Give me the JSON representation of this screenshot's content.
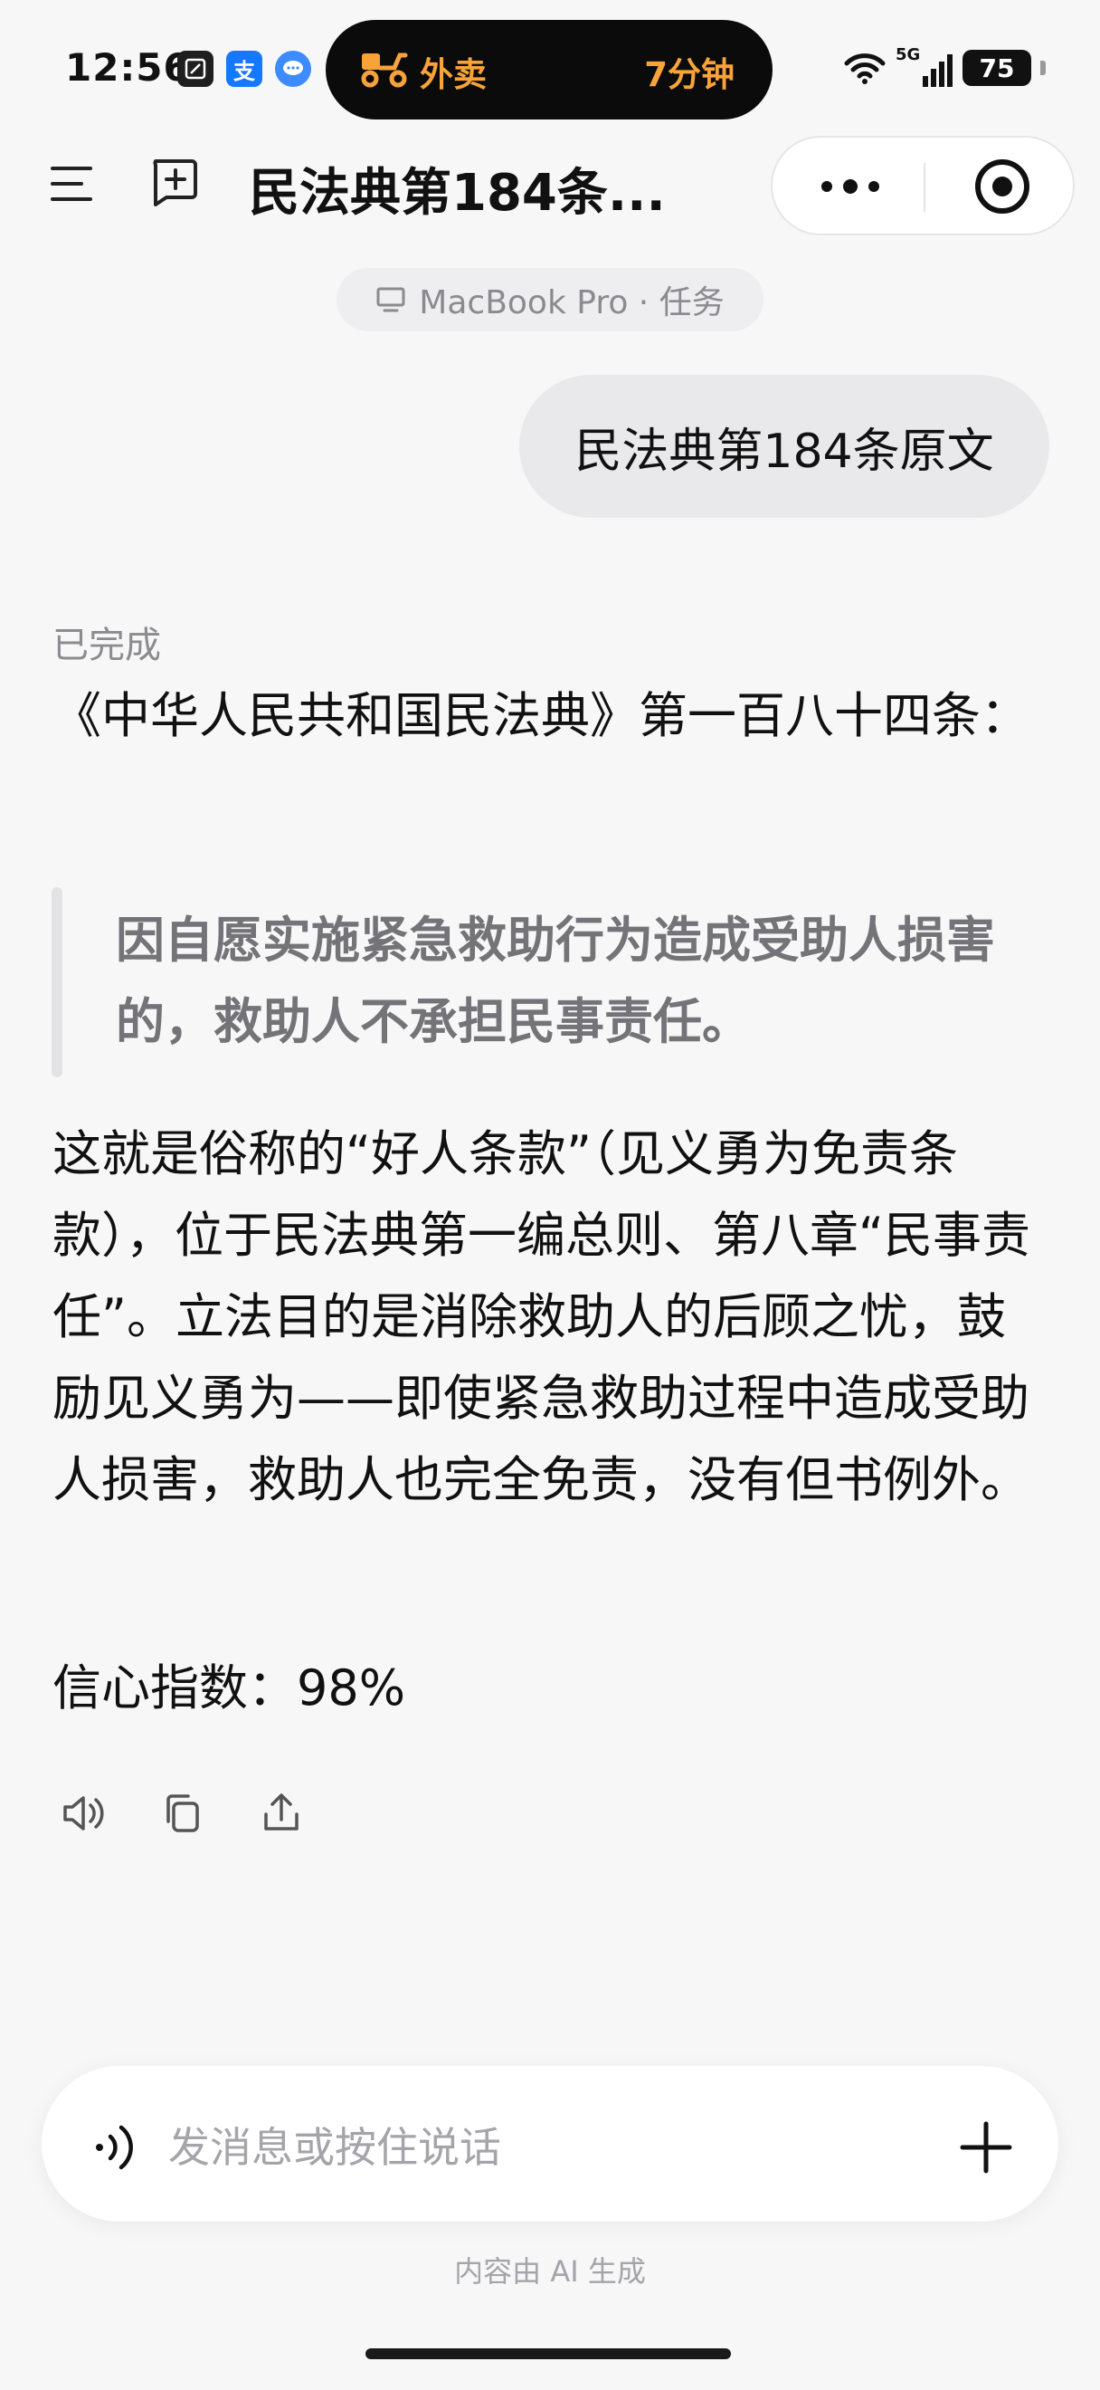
{
  "status_bar": {
    "time": "12:56",
    "app_icons": [
      "doc-app-icon",
      "alipay-icon",
      "chat-bubble-app-icon"
    ],
    "live_activity": {
      "icon": "scooter-icon",
      "label": "外卖",
      "eta": "7分钟"
    },
    "network": "5G",
    "battery": "75"
  },
  "header": {
    "menu_icon": "menu-icon",
    "new_chat_icon": "new-chat-icon",
    "title": "民法典第184条...",
    "more_icon": "more-dots-icon",
    "close_icon": "target-close-icon"
  },
  "device_chip": {
    "icon": "laptop-icon",
    "label": "MacBook Pro · 任务"
  },
  "conversation": {
    "user_message": "民法典第184条原文",
    "ai": {
      "status": "已完成",
      "intro": "《中华人民共和国民法典》第一百八十四条：",
      "quote": "因自愿实施紧急救助行为造成受助人损害的，救助人不承担民事责任。",
      "explanation": "这就是俗称的“好人条款”（见义勇为免责条款），位于民法典第一编总则、第八章“民事责任”。立法目的是消除救助人的后顾之忧，鼓励见义勇为——即使紧急救助过程中造成受助人损害，救助人也完全免责，没有但书例外。",
      "confidence": "信心指数：98%",
      "actions": [
        "speaker-icon",
        "copy-icon",
        "share-icon"
      ]
    }
  },
  "composer": {
    "voice_icon": "voice-wave-icon",
    "placeholder": "发消息或按住说话",
    "add_icon": "plus-icon"
  },
  "footer_note": "内容由 AI 生成",
  "colors": {
    "background": "#f7f7f8",
    "live_activity_accent": "#f7a33a",
    "bubble": "#e9e9ec",
    "muted_text": "#8b8b90"
  }
}
